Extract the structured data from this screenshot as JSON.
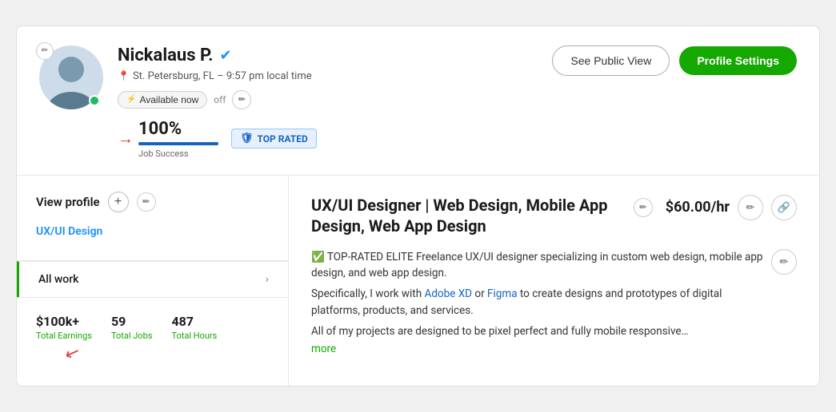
{
  "page": {
    "background": "#f0f0f0"
  },
  "profile": {
    "name": "Nickalaus P.",
    "verified": true,
    "location": "St. Petersburg, FL – 9:57 pm local time",
    "availability": "Available now",
    "availability_toggle": "off",
    "job_success_pct": "100%",
    "job_success_label": "Job Success",
    "top_rated_label": "TOP RATED",
    "see_public_view_label": "See Public View",
    "profile_settings_label": "Profile Settings"
  },
  "sidebar": {
    "view_profile_label": "View profile",
    "profile_type": "UX/UI Design",
    "nav_items": [
      {
        "label": "All work",
        "has_arrow": true
      }
    ],
    "stats": [
      {
        "value": "$100k+",
        "label": "Total Earnings"
      },
      {
        "value": "59",
        "label": "Total Jobs"
      },
      {
        "value": "487",
        "label": "Total Hours"
      }
    ]
  },
  "main": {
    "job_title": "UX/UI Designer | Web Design, Mobile App Design, Web App Design",
    "rate": "$60.00/hr",
    "desc_line1": "✅ TOP-RATED ELITE Freelance UX/UI designer specializing in custom web design, mobile app design, and web app design.",
    "desc_line2": "Specifically, I work with Adobe XD or Figma to create designs and prototypes of digital platforms, products, and services.",
    "desc_line3": "All of my projects are designed to be pixel perfect and fully mobile responsive…",
    "more_label": "more"
  },
  "icons": {
    "edit": "✏",
    "pencil": "✏",
    "plus": "+",
    "arrow_right": "›",
    "verified": "✓",
    "flash": "⚡",
    "shield": "🛡",
    "link": "🔗",
    "pin": "📍"
  }
}
